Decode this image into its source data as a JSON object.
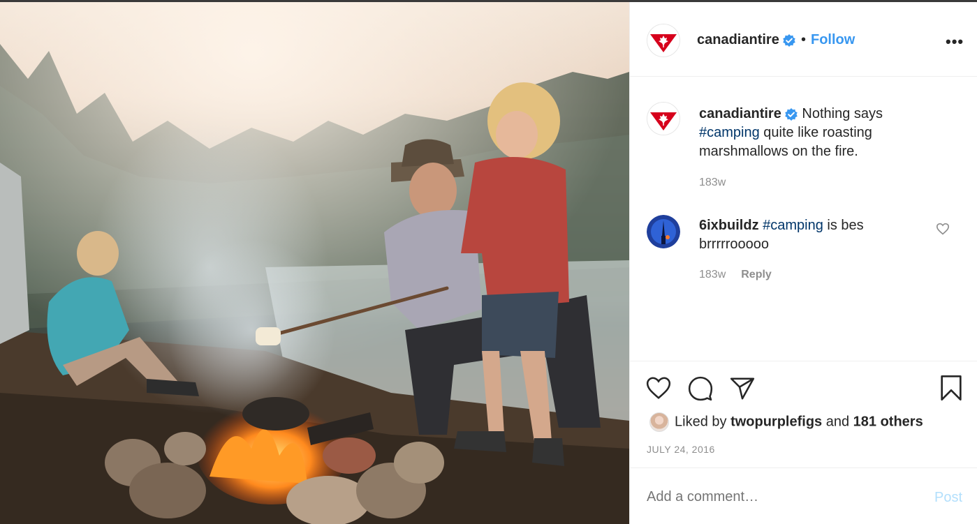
{
  "post": {
    "username": "canadiantire",
    "verified": true,
    "follow_label": "Follow",
    "separator": "•",
    "more_label": "•••"
  },
  "caption": {
    "username": "canadiantire",
    "text_before": " Nothing says ",
    "hashtag": "#camping",
    "text_after": " quite like roasting marshmallows on the fire.",
    "time": "183w"
  },
  "comment": {
    "username": "6ixbuildz",
    "hashtag": "#camping",
    "text_after": " is bes brrrrrooooo",
    "time": "183w",
    "reply_label": "Reply"
  },
  "likes": {
    "prefix": "Liked by ",
    "user": "twopurplefigs",
    "middle": " and ",
    "others": "181 others"
  },
  "date": "JULY 24, 2016",
  "add_comment": {
    "placeholder": "Add a comment…",
    "post_label": "Post"
  },
  "colors": {
    "brand_red": "#d6001c",
    "link_blue": "#3897f0",
    "hashtag": "#003569",
    "post_disabled": "#b2dffc"
  },
  "icons": [
    "heart-icon",
    "comment-icon",
    "share-icon",
    "bookmark-icon",
    "verified-icon",
    "more-icon",
    "small-heart-icon"
  ]
}
